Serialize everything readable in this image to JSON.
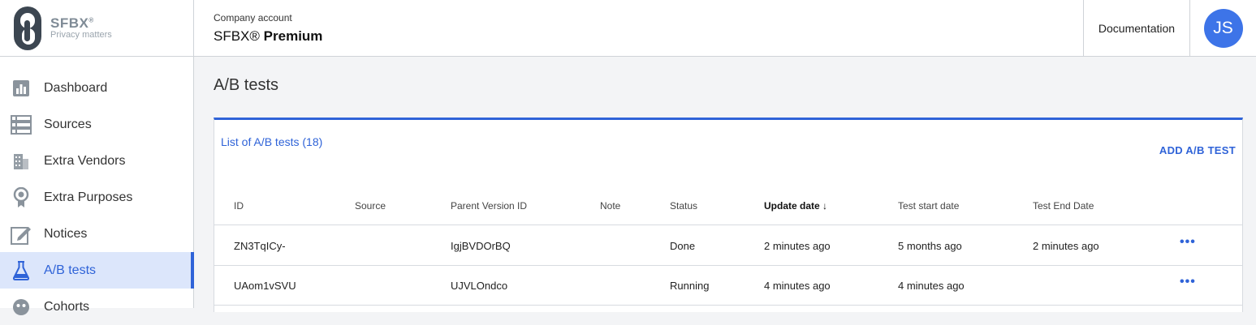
{
  "logo": {
    "name": "SFBX",
    "reg": "®",
    "tagline": "Privacy matters"
  },
  "account": {
    "label": "Company account",
    "name": "SFBX®",
    "plan": "Premium"
  },
  "header": {
    "documentation": "Documentation",
    "avatar_initials": "JS"
  },
  "sidebar": {
    "items": [
      {
        "label": "Dashboard",
        "icon": "chart-icon"
      },
      {
        "label": "Sources",
        "icon": "list-icon"
      },
      {
        "label": "Extra Vendors",
        "icon": "building-icon"
      },
      {
        "label": "Extra Purposes",
        "icon": "award-icon"
      },
      {
        "label": "Notices",
        "icon": "edit-icon"
      },
      {
        "label": "A/B tests",
        "icon": "flask-icon",
        "active": true
      },
      {
        "label": "Cohorts",
        "icon": "cohorts-icon"
      }
    ]
  },
  "page": {
    "title": "A/B tests"
  },
  "list": {
    "title": "List of A/B tests (18)",
    "add_label": "ADD A/B TEST",
    "columns": [
      "ID",
      "Source",
      "Parent Version ID",
      "Note",
      "Status",
      "Update date",
      "Test start date",
      "Test End Date"
    ],
    "sorted_indicator": "↓",
    "rows": [
      {
        "id": "ZN3TqICy-",
        "source": "",
        "parent": "IgjBVDOrBQ",
        "note": "",
        "status": "Done",
        "update": "2 minutes ago",
        "start": "5 months ago",
        "end": "2 minutes ago",
        "more": "•••"
      },
      {
        "id": "UAom1vSVU",
        "source": "",
        "parent": "UJVLOndco",
        "note": "",
        "status": "Running",
        "update": "4 minutes ago",
        "start": "4 minutes ago",
        "end": "",
        "more": "•••"
      }
    ]
  },
  "colors": {
    "accent": "#2f63d8",
    "avatar": "#3d74e8",
    "active_bg": "#dce6fb"
  }
}
